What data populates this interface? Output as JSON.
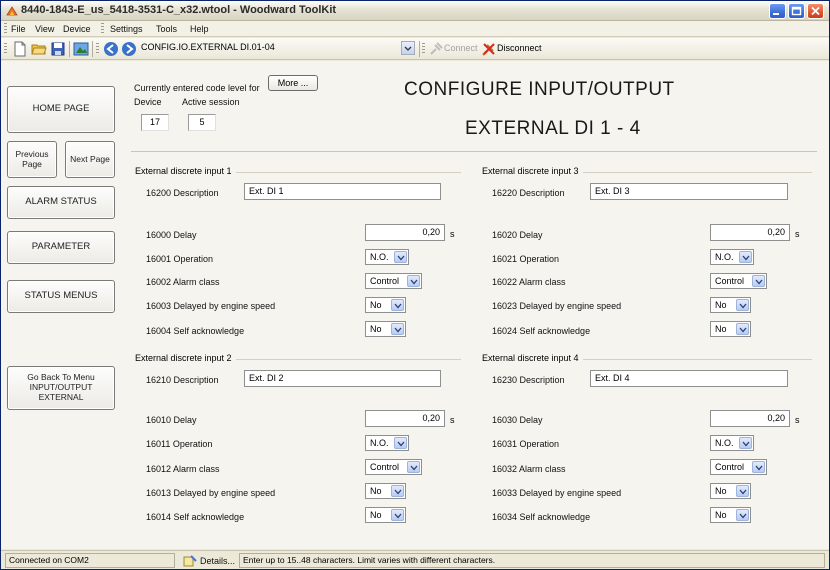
{
  "window": {
    "title": "8440-1843-E_us_5418-3531-C_x32.wtool - Woodward ToolKit"
  },
  "menu": [
    "File",
    "View",
    "Device",
    "Settings",
    "Tools",
    "Help"
  ],
  "toolbar": {
    "config_page": "CONFIG.IO.EXTERNAL DI.01-04",
    "connect_label": "Connect",
    "disconnect_label": "Disconnect"
  },
  "nav": {
    "home": "HOME PAGE",
    "previous": "Previous Page",
    "next": "Next Page",
    "alarm": "ALARM STATUS",
    "parameter": "PARAMETER",
    "status_menus": "STATUS MENUS",
    "go_back": "Go Back To Menu INPUT/OUTPUT EXTERNAL"
  },
  "session": {
    "code_level_label": "Currently entered code level for",
    "device_label": "Device",
    "active_label": "Active session",
    "device_value": "17",
    "active_value": "5",
    "more_label": "More ..."
  },
  "heading": {
    "line1": "CONFIGURE INPUT/OUTPUT",
    "line2": "EXTERNAL DI 1 - 4"
  },
  "groups": [
    {
      "title": "External discrete input 1",
      "desc_label": "16200 Description",
      "desc_value": "Ext. DI 1",
      "delay_label": "16000 Delay",
      "delay_value": "0,20",
      "delay_unit": "s",
      "operation_label": "16001 Operation",
      "operation_value": "N.O.",
      "alarm_label": "16002 Alarm class",
      "alarm_value": "Control",
      "engine_label": "16003 Delayed by engine speed",
      "engine_value": "No",
      "ack_label": "16004 Self acknowledge",
      "ack_value": "No"
    },
    {
      "title": "External discrete input 3",
      "desc_label": "16220 Description",
      "desc_value": "Ext. DI 3",
      "delay_label": "16020 Delay",
      "delay_value": "0,20",
      "delay_unit": "s",
      "operation_label": "16021 Operation",
      "operation_value": "N.O.",
      "alarm_label": "16022 Alarm class",
      "alarm_value": "Control",
      "engine_label": "16023 Delayed by engine speed",
      "engine_value": "No",
      "ack_label": "16024 Self acknowledge",
      "ack_value": "No"
    },
    {
      "title": "External discrete input 2",
      "desc_label": "16210 Description",
      "desc_value": "Ext. DI 2",
      "delay_label": "16010 Delay",
      "delay_value": "0,20",
      "delay_unit": "s",
      "operation_label": "16011 Operation",
      "operation_value": "N.O.",
      "alarm_label": "16012 Alarm class",
      "alarm_value": "Control",
      "engine_label": "16013 Delayed by engine speed",
      "engine_value": "No",
      "ack_label": "16014 Self acknowledge",
      "ack_value": "No"
    },
    {
      "title": "External discrete input 4",
      "desc_label": "16230 Description",
      "desc_value": "Ext. DI 4",
      "delay_label": "16030 Delay",
      "delay_value": "0,20",
      "delay_unit": "s",
      "operation_label": "16031 Operation",
      "operation_value": "N.O.",
      "alarm_label": "16032 Alarm class",
      "alarm_value": "Control",
      "engine_label": "16033 Delayed by engine speed",
      "engine_value": "No",
      "ack_label": "16034 Self acknowledge",
      "ack_value": "No"
    }
  ],
  "status": {
    "connection": "Connected on COM2",
    "details_label": "Details...",
    "hint": "Enter up to 15..48 characters.  Limit varies with different characters."
  },
  "colors": {
    "title_gradient_top": "#fdfdfb",
    "window_bg": "#ece9d8",
    "content_bg": "#f5f4ee",
    "close_button": "#e05530",
    "win_button": "#3e6ed8"
  }
}
